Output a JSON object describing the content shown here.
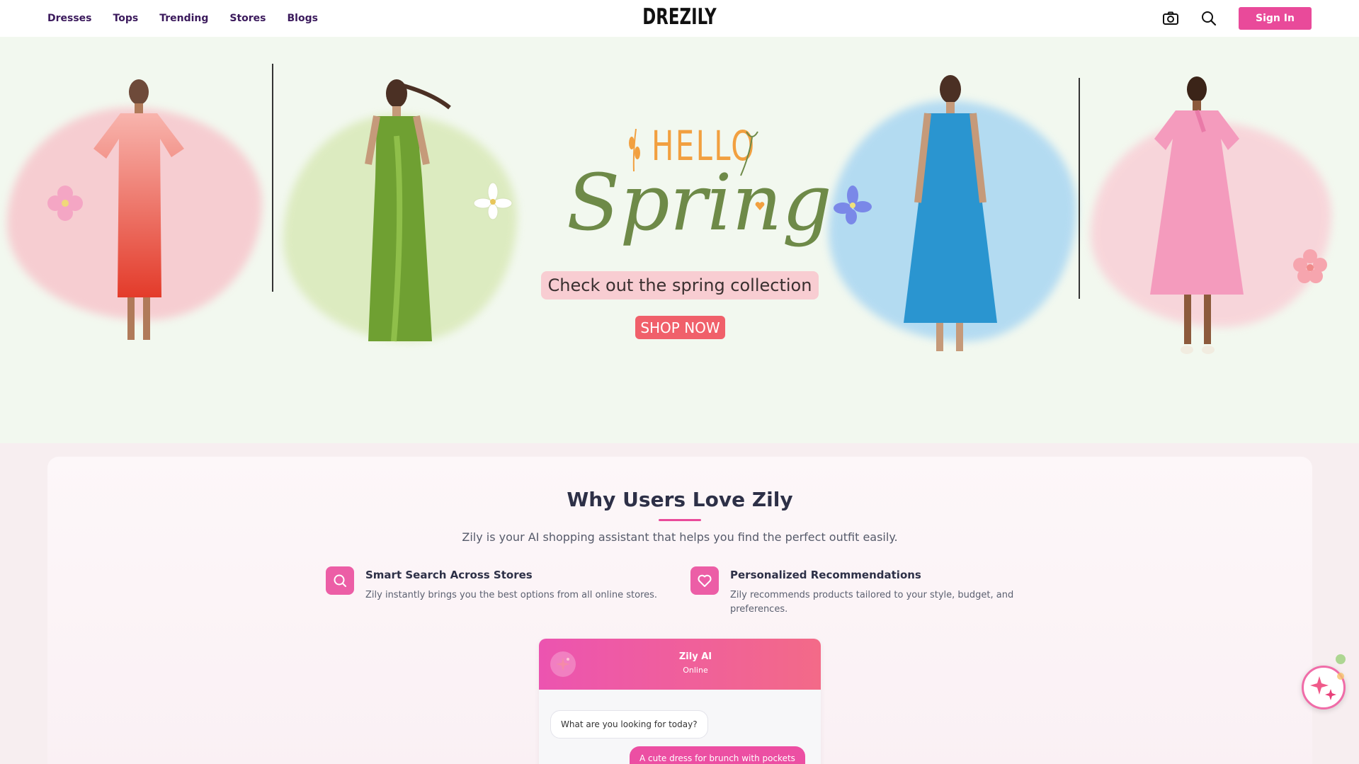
{
  "header": {
    "nav": [
      "Dresses",
      "Tops",
      "Trending",
      "Stores",
      "Blogs"
    ],
    "logo": "DREZILY",
    "icons": [
      "camera-icon",
      "search-icon"
    ],
    "signin_label": "Sign In"
  },
  "hero": {
    "hello": "HELLO",
    "spring": "Spring",
    "tagline": "Check out the spring collection",
    "cta": "SHOP NOW",
    "carousel_dots": 1
  },
  "why": {
    "title": "Why Users Love Zily",
    "subtitle": "Zily is your AI shopping assistant that helps you find the perfect outfit easily.",
    "features": [
      {
        "icon": "search-icon",
        "title": "Smart Search Across Stores",
        "desc": "Zily instantly brings you the best options from all online stores."
      },
      {
        "icon": "heart-icon",
        "title": "Personalized Recommendations",
        "desc": "Zily recommends products tailored to your style, budget, and preferences."
      }
    ]
  },
  "chat": {
    "name": "Zily AI",
    "status": "Online",
    "bot_message": "What are you looking for today?",
    "user_message": "A cute dress for brunch with pockets"
  },
  "colors": {
    "brand_pink": "#e94a9a",
    "nav_text": "#3b1a5c",
    "hero_bg": "#f2f8ef",
    "cta_red": "#f0606a",
    "spring_green": "#6e8a48",
    "hello_orange": "#f2a040"
  }
}
